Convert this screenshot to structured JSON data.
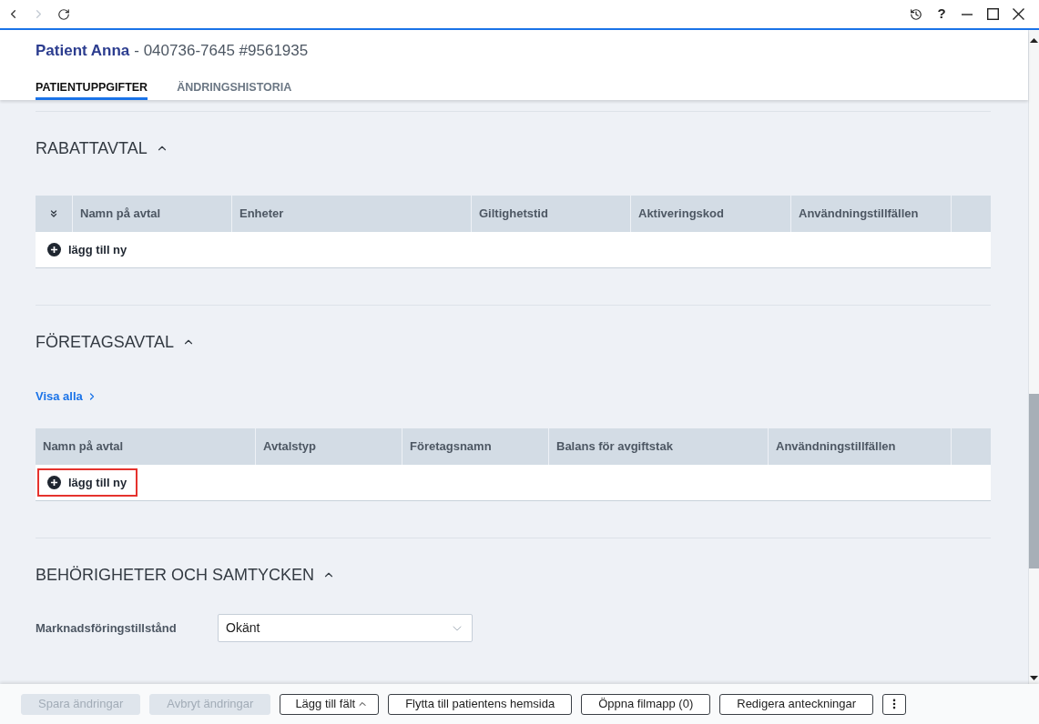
{
  "nav": [
    {
      "kind": "back",
      "disabled": false
    },
    {
      "kind": "forward",
      "disabled": true
    },
    {
      "kind": "refresh",
      "disabled": false
    }
  ],
  "window_controls": [
    {
      "kind": "history"
    },
    {
      "kind": "help",
      "label": "?"
    },
    {
      "kind": "minimize"
    },
    {
      "kind": "maximize"
    },
    {
      "kind": "close"
    }
  ],
  "header": {
    "patient_name": "Patient Anna",
    "identifiers": "- 040736-7645 #9561935"
  },
  "tabs": [
    {
      "label": "PATIENTUPPGIFTER",
      "selected": true
    },
    {
      "label": "ÄNDRINGSHISTORIA",
      "selected": false
    }
  ],
  "sections": [
    {
      "title": "RABATTAVTAL",
      "expanded": true,
      "table": {
        "expand_column": true,
        "columns": [
          "Namn på avtal",
          "Enheter",
          "Giltighetstid",
          "Aktiveringskod",
          "Användningstillfällen"
        ],
        "add_row": {
          "label": "lägg till ny",
          "highlighted": false
        }
      }
    },
    {
      "title": "FÖRETAGSAVTAL",
      "expanded": true,
      "link": "Visa alla",
      "table": {
        "expand_column": false,
        "columns": [
          "Namn på avtal",
          "Avtalstyp",
          "Företagsnamn",
          "Balans för avgiftstak",
          "Användningstillfällen"
        ],
        "add_row": {
          "label": "lägg till ny",
          "highlighted": true
        }
      }
    },
    {
      "title": "BEHÖRIGHETER OCH SAMTYCKEN",
      "expanded": true,
      "fields": [
        {
          "label": "Marknadsföringstillstånd",
          "value": "Okänt"
        }
      ]
    }
  ],
  "footer_buttons": [
    {
      "kind": "text",
      "label": "Spara ändringar",
      "disabled": true
    },
    {
      "kind": "text",
      "label": "Avbryt ändringar",
      "disabled": true
    },
    {
      "kind": "menu",
      "label": "Lägg till fält",
      "disabled": false
    },
    {
      "kind": "text",
      "label": "Flytta till patientens hemsida",
      "disabled": false
    },
    {
      "kind": "text",
      "label": "Öppna filmapp (0)",
      "disabled": false
    },
    {
      "kind": "text",
      "label": "Redigera anteckningar",
      "disabled": false
    },
    {
      "kind": "more",
      "disabled": false
    }
  ]
}
